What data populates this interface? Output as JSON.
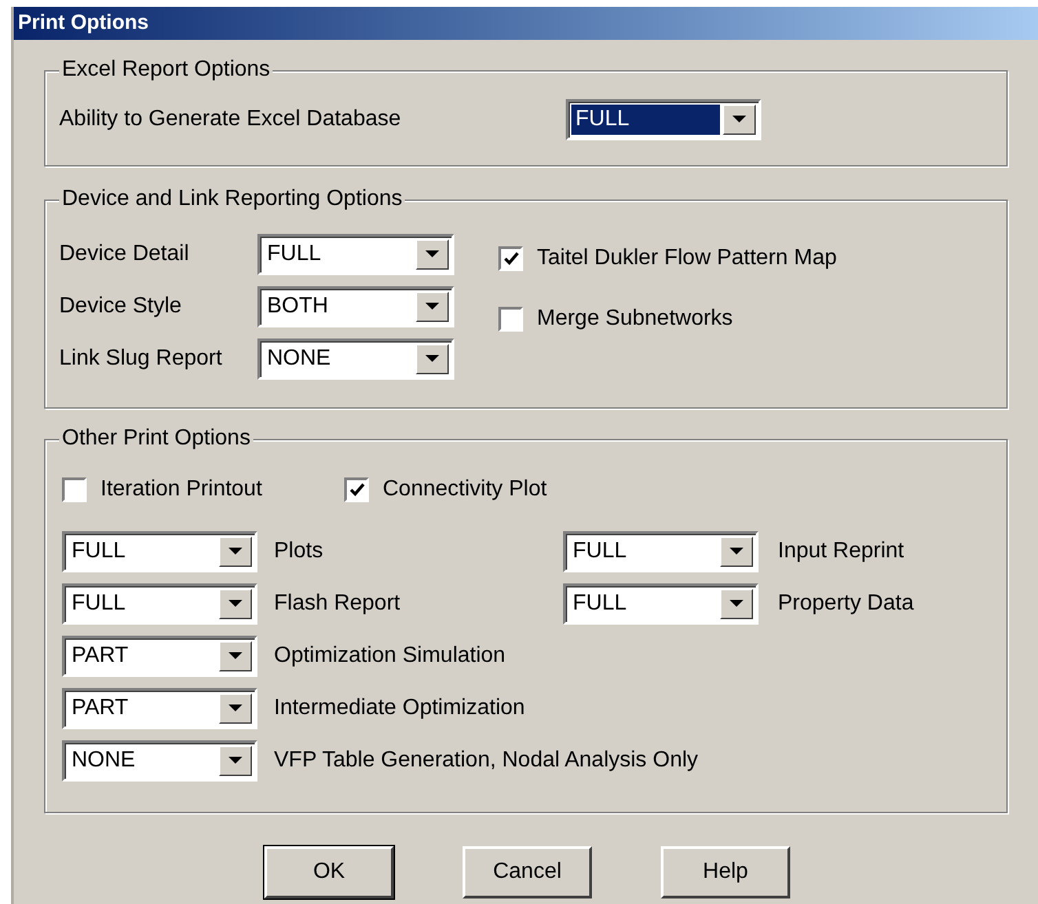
{
  "window": {
    "title": "Print Options"
  },
  "excel_group": {
    "title": "Excel Report Options",
    "label": "Ability to Generate Excel Database",
    "combo": {
      "value": "FULL",
      "focused": true
    }
  },
  "device_group": {
    "title": "Device and Link Reporting Options",
    "rows": [
      {
        "label": "Device Detail",
        "combo": {
          "value": "FULL",
          "focused": false
        }
      },
      {
        "label": "Device Style",
        "combo": {
          "value": "BOTH",
          "focused": false
        }
      },
      {
        "label": "Link Slug Report",
        "combo": {
          "value": "NONE",
          "focused": false
        }
      }
    ],
    "checkboxes": [
      {
        "label": "Taitel Dukler Flow Pattern Map",
        "checked": true
      },
      {
        "label": "Merge Subnetworks",
        "checked": false
      }
    ]
  },
  "other_group": {
    "title": "Other Print Options",
    "checkboxes": [
      {
        "label": "Iteration Printout",
        "checked": false
      },
      {
        "label": "Connectivity Plot",
        "checked": true
      }
    ],
    "left_rows": [
      {
        "label": "Plots",
        "combo": {
          "value": "FULL",
          "focused": false
        }
      },
      {
        "label": "Flash Report",
        "combo": {
          "value": "FULL",
          "focused": false
        }
      },
      {
        "label": "Optimization Simulation",
        "combo": {
          "value": "PART",
          "focused": false
        }
      },
      {
        "label": "Intermediate Optimization",
        "combo": {
          "value": "PART",
          "focused": false
        }
      },
      {
        "label": "VFP Table Generation, Nodal Analysis Only",
        "combo": {
          "value": "NONE",
          "focused": false
        }
      }
    ],
    "right_rows": [
      {
        "label": "Input Reprint",
        "combo": {
          "value": "FULL",
          "focused": false
        }
      },
      {
        "label": "Property Data",
        "combo": {
          "value": "FULL",
          "focused": false
        }
      }
    ]
  },
  "buttons": [
    {
      "label": "OK",
      "default": true
    },
    {
      "label": "Cancel",
      "default": false
    },
    {
      "label": "Help",
      "default": false
    }
  ]
}
